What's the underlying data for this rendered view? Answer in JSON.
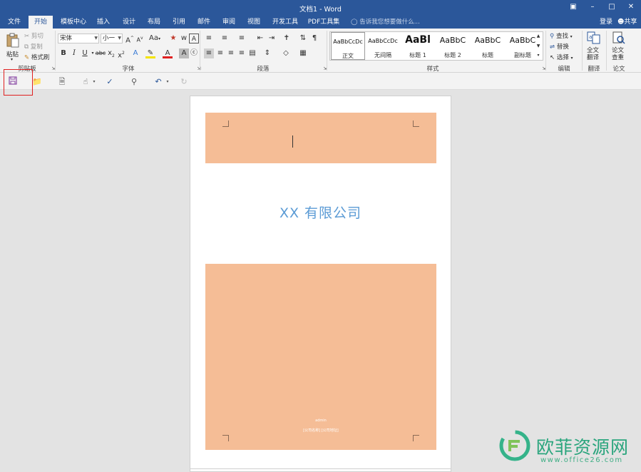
{
  "window": {
    "title": "文档1 - Word"
  },
  "tabs": [
    {
      "label": "文件",
      "active": false
    },
    {
      "label": "开始",
      "active": true
    },
    {
      "label": "模板中心",
      "active": false
    },
    {
      "label": "插入",
      "active": false
    },
    {
      "label": "设计",
      "active": false
    },
    {
      "label": "布局",
      "active": false
    },
    {
      "label": "引用",
      "active": false
    },
    {
      "label": "邮件",
      "active": false
    },
    {
      "label": "审阅",
      "active": false
    },
    {
      "label": "视图",
      "active": false
    },
    {
      "label": "开发工具",
      "active": false
    },
    {
      "label": "PDF工具集",
      "active": false
    }
  ],
  "tellme": "告诉我您想要做什么...",
  "account": {
    "signin": "登录",
    "share": "共享"
  },
  "ribbon": {
    "clipboard": {
      "paste": "粘贴",
      "cut": "剪切",
      "copy": "复制",
      "format_painter": "格式刷",
      "group": "剪贴板"
    },
    "font": {
      "font_name": "宋体",
      "font_size": "小一",
      "group": "字体"
    },
    "paragraph": {
      "group": "段落"
    },
    "styles": {
      "group": "样式",
      "items": [
        {
          "sample": "AaBbCcDc",
          "name": "正文"
        },
        {
          "sample": "AaBbCcDc",
          "name": "无间隔"
        },
        {
          "sample": "AaBl",
          "name": "标题 1"
        },
        {
          "sample": "AaBbC",
          "name": "标题 2"
        },
        {
          "sample": "AaBbC",
          "name": "标题"
        },
        {
          "sample": "AaBbC",
          "name": "副标题"
        }
      ]
    },
    "editing": {
      "find": "查找",
      "replace": "替换",
      "select": "选择",
      "group": "编辑"
    },
    "translate": {
      "label_top": "全文",
      "label_bottom": "翻译",
      "group": "翻译"
    },
    "paper": {
      "label_top": "论文",
      "label_bottom": "查重",
      "group": "论文"
    }
  },
  "document": {
    "company": "XX 有限公司",
    "author": "admin",
    "address": "[公司名称] [公司地址]"
  },
  "watermark": {
    "text": "欧菲资源网",
    "url": "www.office26.com"
  },
  "colors": {
    "title_bar": "#2b579a",
    "band": "#f5bd96",
    "company_text": "#5b9bd5",
    "highlight_box": "#e02020",
    "watermark": "#2aa57d"
  }
}
